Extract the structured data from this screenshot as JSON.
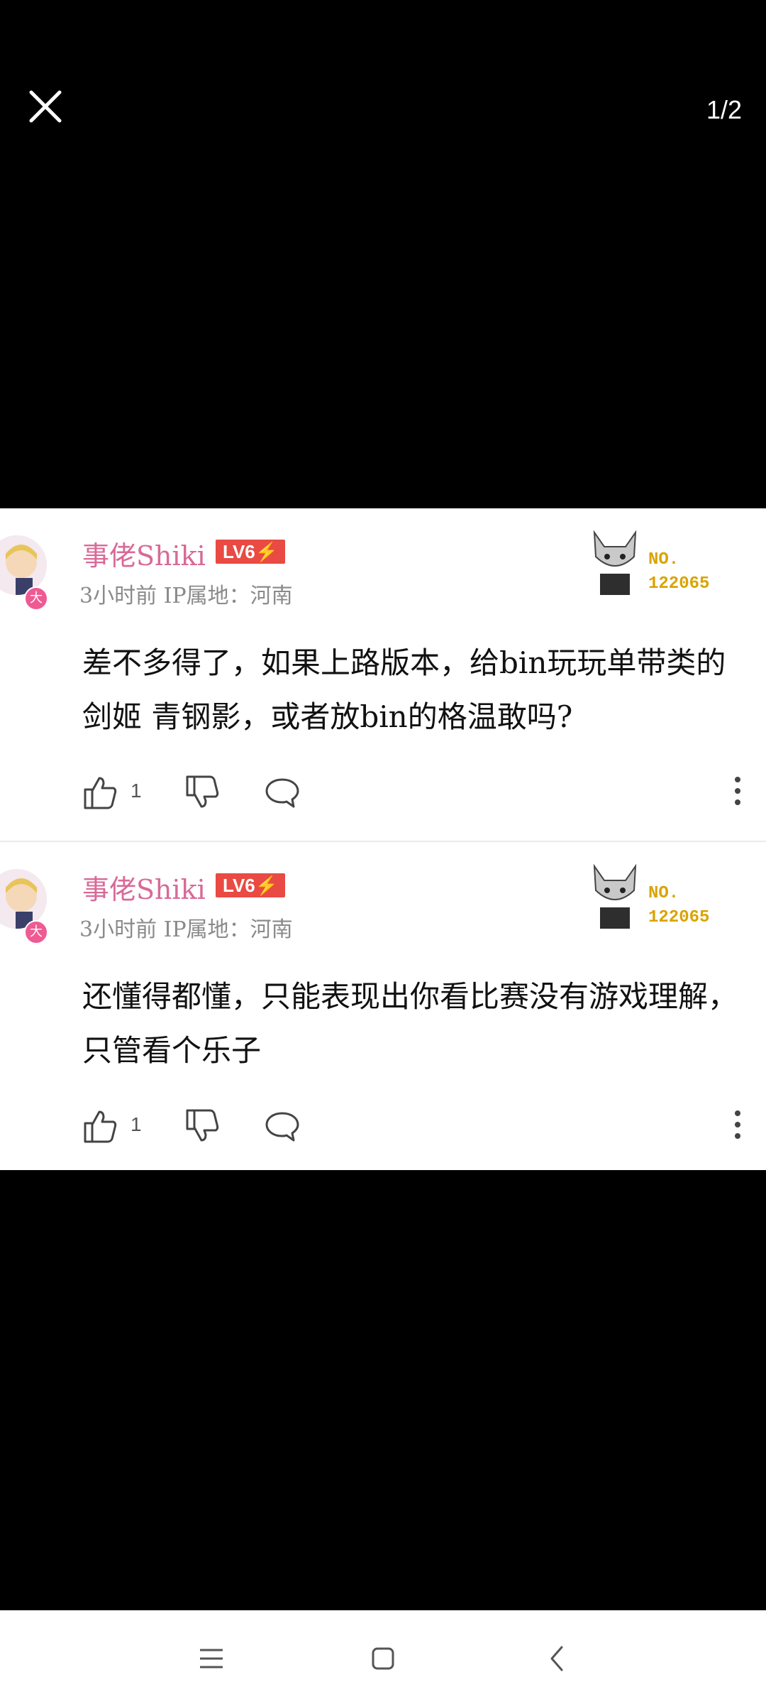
{
  "viewer": {
    "page_indicator": "1/2"
  },
  "comments": [
    {
      "username": "事佬Shiki",
      "level": "LV6⚡",
      "meta": "3小时前  IP属地：河南",
      "medal_no": "NO.",
      "medal_id": "122065",
      "avatar_badge": "大",
      "text": "差不多得了，如果上路版本，给bin玩玩单带类的剑姬 青钢影，或者放bin的格温敢吗?",
      "like_count": "1"
    },
    {
      "username": "事佬Shiki",
      "level": "LV6⚡",
      "meta": "3小时前  IP属地：河南",
      "medal_no": "NO.",
      "medal_id": "122065",
      "avatar_badge": "大",
      "text": "还懂得都懂，只能表现出你看比赛没有游戏理解，只管看个乐子",
      "like_count": "1"
    }
  ],
  "icons": {
    "close": "close-icon",
    "like": "thumbs-up-icon",
    "dislike": "thumbs-down-icon",
    "reply": "comment-bubble-icon",
    "more": "more-vertical-icon",
    "nav_menu": "menu-icon",
    "nav_home": "home-square-icon",
    "nav_back": "back-chevron-icon"
  },
  "colors": {
    "username": "#d86a98",
    "level_badge": "#e94a43",
    "medal": "#d9a400"
  }
}
